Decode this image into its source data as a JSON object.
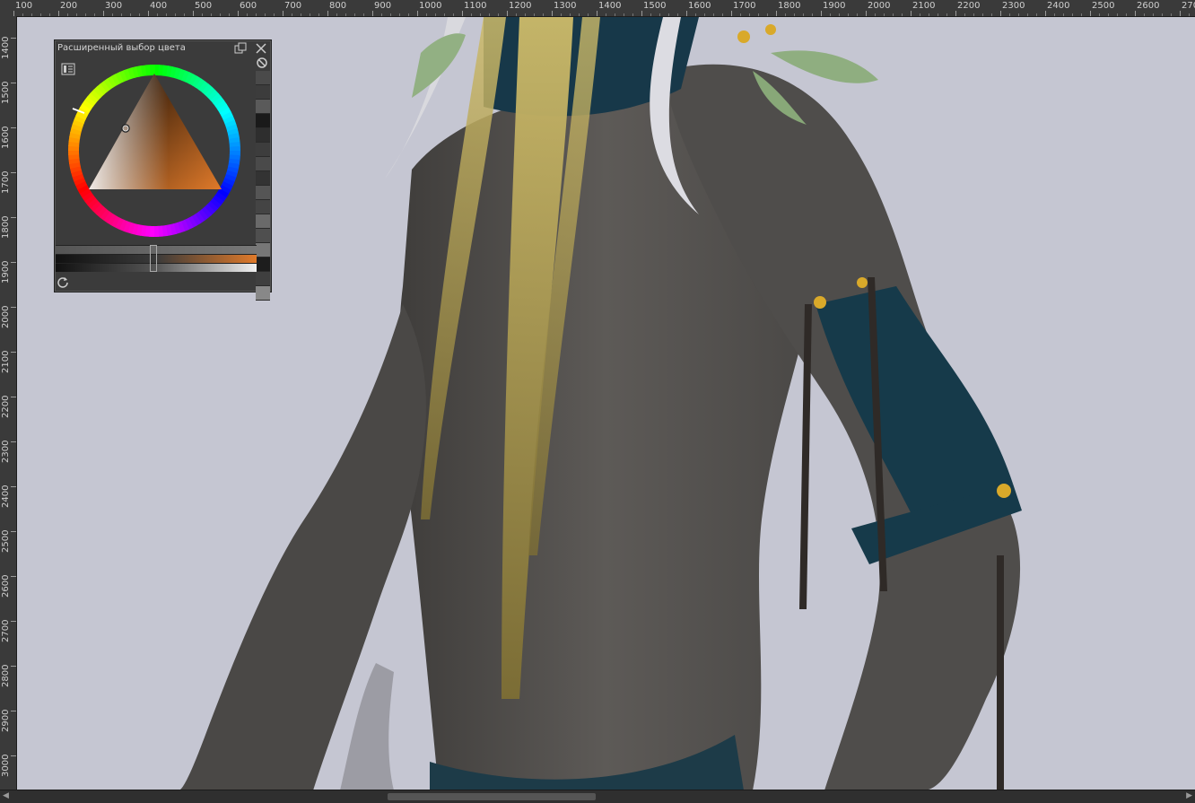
{
  "ruler_top": {
    "labels": [
      "100",
      "200",
      "300",
      "400",
      "500",
      "600",
      "700",
      "800",
      "900",
      "1000",
      "1100",
      "1200",
      "1300",
      "1400",
      "1500",
      "1600",
      "1700",
      "1800",
      "1900",
      "2000",
      "2100",
      "2200",
      "2300",
      "2400",
      "2500",
      "2600",
      "270"
    ]
  },
  "ruler_left": {
    "labels": [
      "1400",
      "1500",
      "1600",
      "1700",
      "1800",
      "1900",
      "2000",
      "2100",
      "2200",
      "2300",
      "2400",
      "2500",
      "2600",
      "2700",
      "2800",
      "2900",
      "3000"
    ]
  },
  "docker": {
    "title": "Расширенный выбор цвета",
    "float_icon": "float-window-icon",
    "close_icon": "close-icon",
    "settings_icon": "color-settings-icon",
    "clear_icon": "no-color-icon",
    "refresh_icon": "refresh-icon",
    "current_color": "#e07a2a",
    "swatches": [
      "#4a4a4a",
      "#3c3c3c",
      "#5a5a5a",
      "#1a1a1a",
      "#2e2e2e",
      "#3d3d3d",
      "#4a4a4a",
      "#333333",
      "#555555",
      "#444444",
      "#6a6a6a",
      "#4f4f4f",
      "#777777",
      "#1d1d1d",
      "#3f3f3f",
      "#888888"
    ]
  },
  "colors": {
    "canvas_bg": "#c5c6d2",
    "skin": "#5a5856",
    "hair_gold": "#b8a455",
    "cloth_teal": "#163a4a"
  }
}
